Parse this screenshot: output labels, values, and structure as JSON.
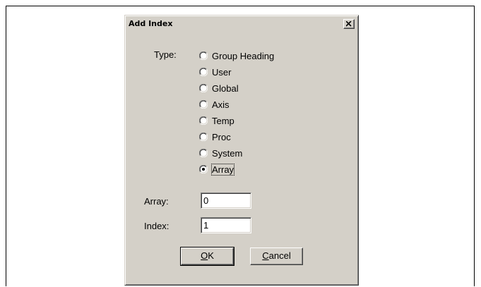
{
  "dialog": {
    "title": "Add Index",
    "close_icon": "close-x-icon"
  },
  "type_group": {
    "label": "Type:",
    "selected": "Array",
    "options": [
      {
        "label": "Group Heading",
        "checked": false
      },
      {
        "label": "User",
        "checked": false
      },
      {
        "label": "Global",
        "checked": false
      },
      {
        "label": "Axis",
        "checked": false
      },
      {
        "label": "Temp",
        "checked": false
      },
      {
        "label": "Proc",
        "checked": false
      },
      {
        "label": "System",
        "checked": false
      },
      {
        "label": "Array",
        "checked": true
      }
    ]
  },
  "array_field": {
    "label": "Array:",
    "value": "0"
  },
  "index_field": {
    "label": "Index:",
    "value": "1"
  },
  "buttons": {
    "ok": {
      "prefix": "",
      "mnemonic": "O",
      "suffix": "K"
    },
    "cancel": {
      "prefix": "",
      "mnemonic": "C",
      "suffix": "ancel"
    }
  },
  "colors": {
    "dialog_face": "#d4d0c8",
    "field_background": "#ffffff"
  }
}
